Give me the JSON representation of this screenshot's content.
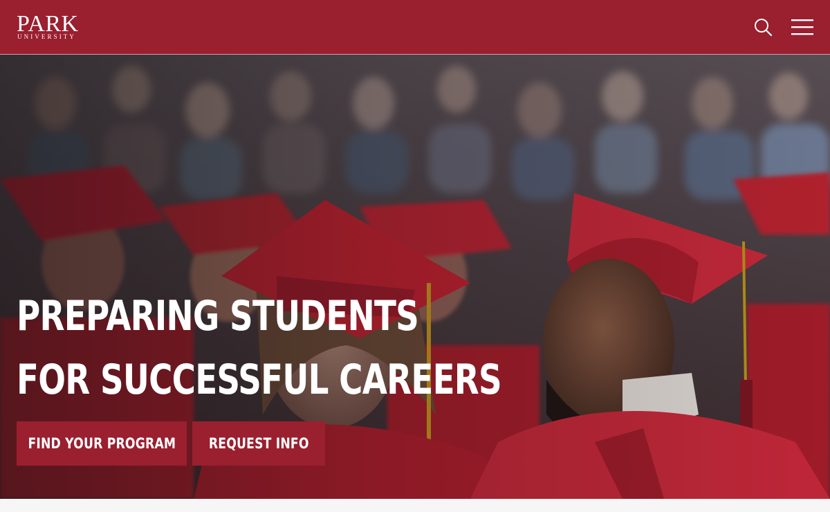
{
  "header": {
    "logo_main": "PARK",
    "logo_sub": "UNIVERSITY",
    "search_icon": "search-icon",
    "menu_icon": "hamburger-menu-icon",
    "brand_color": "#9a1f2f"
  },
  "hero": {
    "headline_line1": "PREPARING STUDENTS",
    "headline_line2": "FOR SUCCESSFUL CAREERS",
    "primary_cta": "FIND YOUR PROGRAM",
    "secondary_cta": "REQUEST INFO",
    "cap_color": "#c8283a"
  }
}
